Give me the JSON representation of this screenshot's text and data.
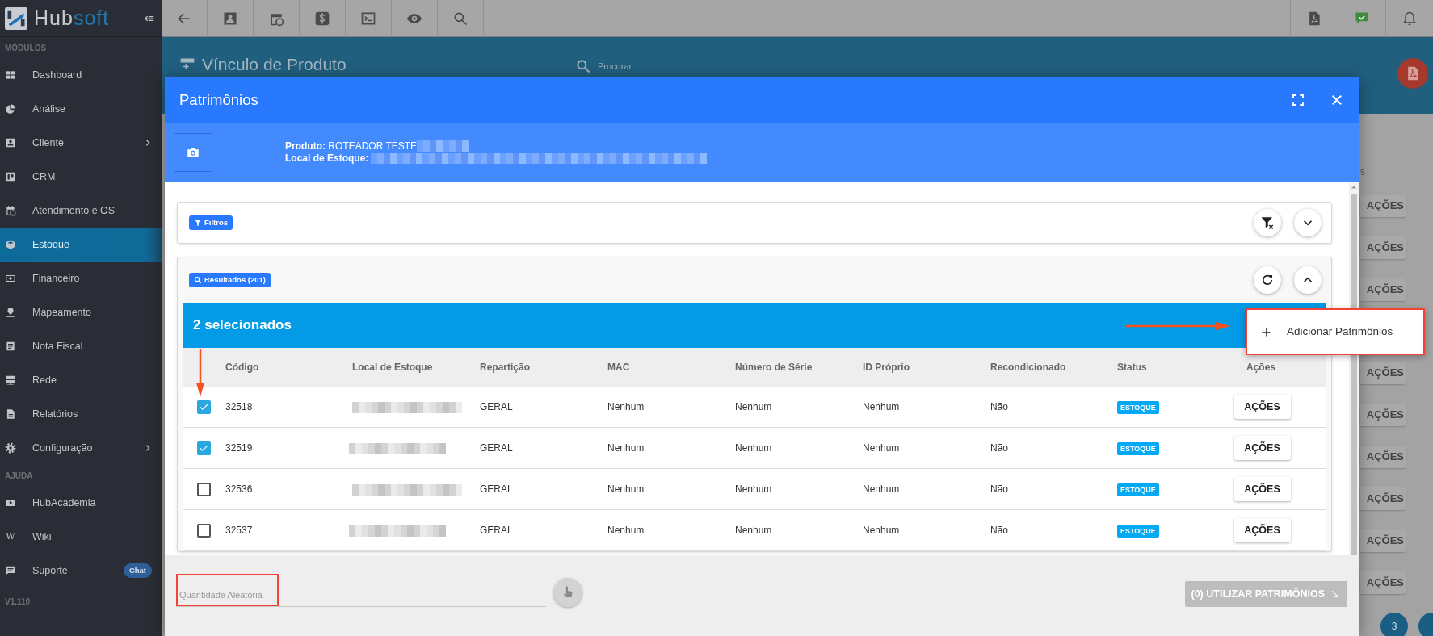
{
  "sidebar": {
    "logo": {
      "first": "Hub",
      "second": "soft"
    },
    "sections": [
      {
        "title": "MÓDULOS",
        "items": [
          {
            "label": "Dashboard",
            "selected": false,
            "has_submenu": false
          },
          {
            "label": "Análise",
            "selected": false,
            "has_submenu": false
          },
          {
            "label": "Cliente",
            "selected": false,
            "has_submenu": true
          },
          {
            "label": "CRM",
            "selected": false,
            "has_submenu": false
          },
          {
            "label": "Atendimento e OS",
            "selected": false,
            "has_submenu": false
          },
          {
            "label": "Estoque",
            "selected": true,
            "has_submenu": false
          },
          {
            "label": "Financeiro",
            "selected": false,
            "has_submenu": false
          },
          {
            "label": "Mapeamento",
            "selected": false,
            "has_submenu": false
          },
          {
            "label": "Nota Fiscal",
            "selected": false,
            "has_submenu": false
          },
          {
            "label": "Rede",
            "selected": false,
            "has_submenu": false
          },
          {
            "label": "Relatórios",
            "selected": false,
            "has_submenu": false
          },
          {
            "label": "Configuração",
            "selected": false,
            "has_submenu": true
          }
        ]
      },
      {
        "title": "AJUDA",
        "items": [
          {
            "label": "HubAcademia",
            "selected": false,
            "has_submenu": false
          },
          {
            "label": "Wiki",
            "selected": false,
            "has_submenu": false,
            "icon_text": "W"
          },
          {
            "label": "Suporte",
            "selected": false,
            "has_submenu": false,
            "badge": "Chat"
          }
        ]
      }
    ],
    "version": "V1.110"
  },
  "page": {
    "title": "Vínculo de Produto",
    "search_placeholder": "Procurar",
    "column_header": "s",
    "row_actions": [
      "AÇÕES",
      "AÇÕES",
      "AÇÕES",
      "AÇÕES",
      "AÇÕES",
      "AÇÕES",
      "AÇÕES",
      "AÇÕES",
      "AÇÕES"
    ],
    "pagination": [
      "3"
    ]
  },
  "modal": {
    "title": "Patrimônios",
    "product": {
      "label": "Produto:",
      "value": "ROTEADOR TESTE"
    },
    "stock_location": {
      "label": "Local de Estoque:"
    },
    "filters_chip": "Filtros",
    "results_chip": "Resultados (201)",
    "selection_title": "2 selecionados",
    "columns": [
      "Código",
      "Local de Estoque",
      "Repartição",
      "MAC",
      "Número de Série",
      "ID Próprio",
      "Recondicionado",
      "Status",
      "Ações"
    ],
    "rows": [
      {
        "selected": true,
        "code": "32518",
        "division": "GERAL",
        "mac": "Nenhum",
        "serial": "Nenhum",
        "own_id": "Nenhum",
        "refurbished": "Não",
        "status": "ESTOQUE",
        "action": "AÇÕES"
      },
      {
        "selected": true,
        "code": "32519",
        "division": "GERAL",
        "mac": "Nenhum",
        "serial": "Nenhum",
        "own_id": "Nenhum",
        "refurbished": "Não",
        "status": "ESTOQUE",
        "action": "AÇÕES"
      },
      {
        "selected": false,
        "code": "32536",
        "division": "GERAL",
        "mac": "Nenhum",
        "serial": "Nenhum",
        "own_id": "Nenhum",
        "refurbished": "Não",
        "status": "ESTOQUE",
        "action": "AÇÕES"
      },
      {
        "selected": false,
        "code": "32537",
        "division": "GERAL",
        "mac": "Nenhum",
        "serial": "Nenhum",
        "own_id": "Nenhum",
        "refurbished": "Não",
        "status": "ESTOQUE",
        "action": "AÇÕES"
      }
    ],
    "menu": [
      {
        "label": "Adicionar Patrimônios"
      }
    ],
    "footer": {
      "quantity": {
        "placeholder": "Quantidade Aleatória"
      },
      "use_button": {
        "label": "(0) UTILIZAR PATRIMÔNIOS",
        "disabled": true
      }
    }
  }
}
